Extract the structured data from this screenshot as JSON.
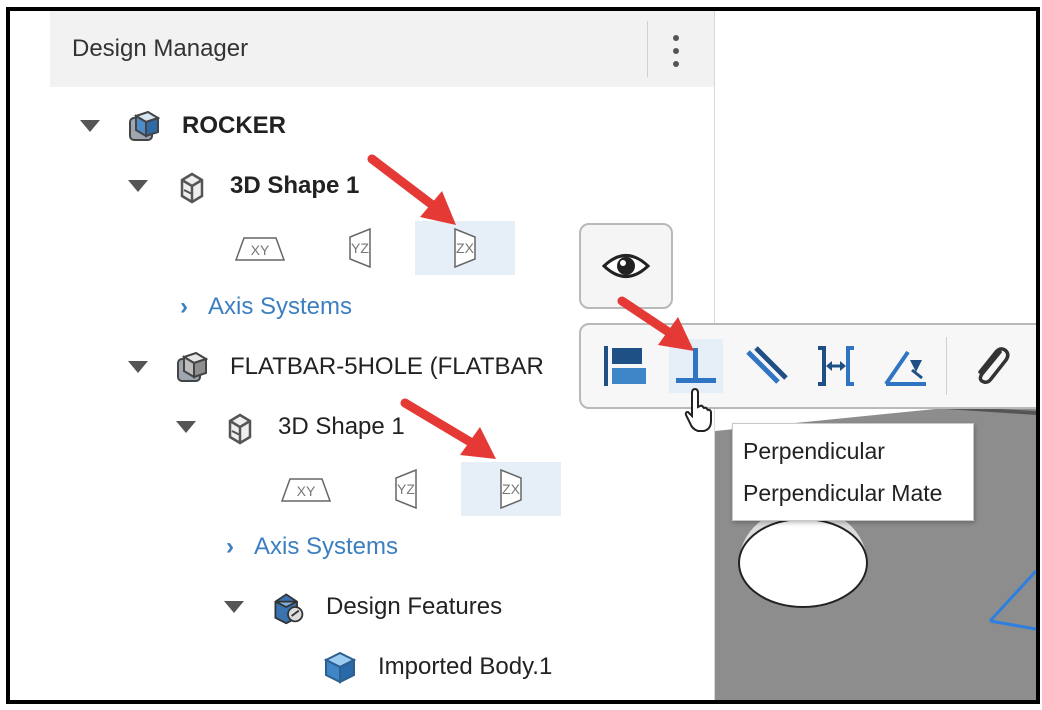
{
  "panel": {
    "title": "Design Manager",
    "menu_icon": "kebab-menu-icon"
  },
  "tree": {
    "root": {
      "label": "ROCKER",
      "icon": "assembly-icon"
    },
    "shape1": {
      "label": "3D Shape 1",
      "icon": "3d-shape-icon"
    },
    "shape1_planes": [
      "XY",
      "YZ",
      "ZX"
    ],
    "shape1_selected_plane": "ZX",
    "axis_systems_1": "Axis Systems",
    "flatbar": {
      "label": "FLATBAR-5HOLE (FLATBAR",
      "icon": "assembly-icon"
    },
    "shape2": {
      "label": "3D Shape 1",
      "icon": "3d-shape-icon"
    },
    "shape2_planes": [
      "XY",
      "YZ",
      "ZX"
    ],
    "shape2_selected_plane": "ZX",
    "axis_systems_2": "Axis Systems",
    "design_features": {
      "label": "Design Features",
      "icon": "design-features-icon"
    },
    "imported_body": {
      "label": "Imported Body.1",
      "icon": "body-icon"
    }
  },
  "floating": {
    "visibility_icon": "eye-icon",
    "tools": [
      "align-icon",
      "perpendicular-icon",
      "parallel-icon",
      "distance-icon",
      "angle-icon",
      "attach-icon"
    ],
    "selected_tool": "perpendicular-icon"
  },
  "tooltip": {
    "line1": "Perpendicular",
    "line2": "Perpendicular Mate"
  },
  "colors": {
    "accent": "#3c7fc0",
    "selection": "#e6eff8",
    "arrow": "#e53935",
    "model": "#8d8d8d"
  }
}
